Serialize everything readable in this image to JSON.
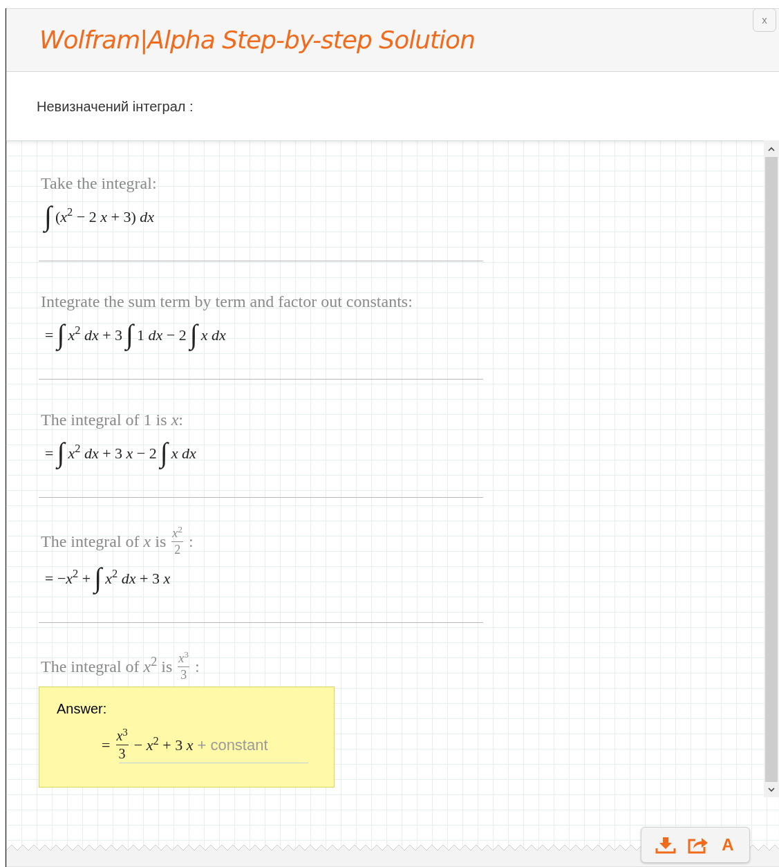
{
  "dialog": {
    "title": "Wolfram|Alpha Step-by-step Solution",
    "close": "x"
  },
  "subtitle": "Невизначений інтеграл :",
  "steps": [
    {
      "description": [
        {
          "kind": "text",
          "s": "Take the integral:"
        }
      ],
      "formula": [
        {
          "kind": "integral",
          "s": "∫"
        },
        {
          "kind": "text",
          "s": "(*x*$^{2}$ − 2 *x* + 3) *dx*"
        }
      ]
    },
    {
      "description": [
        {
          "kind": "text",
          "s": "Integrate the sum term by term and factor out constants:"
        }
      ],
      "formula": [
        {
          "kind": "text",
          "s": "="
        },
        {
          "kind": "integral",
          "s": "∫"
        },
        {
          "kind": "text",
          "s": "*x*$^{2}$ *dx* + 3"
        },
        {
          "kind": "integral",
          "s": "∫"
        },
        {
          "kind": "text",
          "s": "1 *dx* − 2"
        },
        {
          "kind": "integral",
          "s": "∫"
        },
        {
          "kind": "text",
          "s": "*x dx*"
        }
      ]
    },
    {
      "description": [
        {
          "kind": "text",
          "s": "The integral of 1 is *x*:"
        }
      ],
      "formula": [
        {
          "kind": "text",
          "s": "="
        },
        {
          "kind": "integral",
          "s": "∫"
        },
        {
          "kind": "text",
          "s": "*x*$^{2}$ *dx* + 3 *x* − 2"
        },
        {
          "kind": "integral",
          "s": "∫"
        },
        {
          "kind": "text",
          "s": "*x dx*"
        }
      ]
    },
    {
      "description": [
        {
          "kind": "text",
          "s": "The integral of *x* is"
        },
        {
          "kind": "frac",
          "num": "*x*$^{2}$",
          "den": "2"
        },
        {
          "kind": "text",
          "s": ":"
        }
      ],
      "formula": [
        {
          "kind": "text",
          "s": "= −*x*$^{2}$ +"
        },
        {
          "kind": "integral",
          "s": "∫"
        },
        {
          "kind": "text",
          "s": "*x*$^{2}$ *dx* + 3 *x*"
        }
      ]
    },
    {
      "description": [
        {
          "kind": "text",
          "s": "The integral of *x*$^{2}$ is"
        },
        {
          "kind": "frac",
          "num": "*x*$^{3}$",
          "den": "3"
        },
        {
          "kind": "text",
          "s": ":"
        }
      ]
    }
  ],
  "answer": {
    "label": "Answer:",
    "formula": [
      {
        "kind": "text",
        "s": "="
      },
      {
        "kind": "frac",
        "num": "*x*$^{3}$",
        "den": "3"
      },
      {
        "kind": "text",
        "s": "− *x*$^{2}$ + 3 *x*"
      },
      {
        "kind": "note",
        "s": "+ constant"
      }
    ]
  },
  "toolbar": {
    "font_button": "A"
  }
}
